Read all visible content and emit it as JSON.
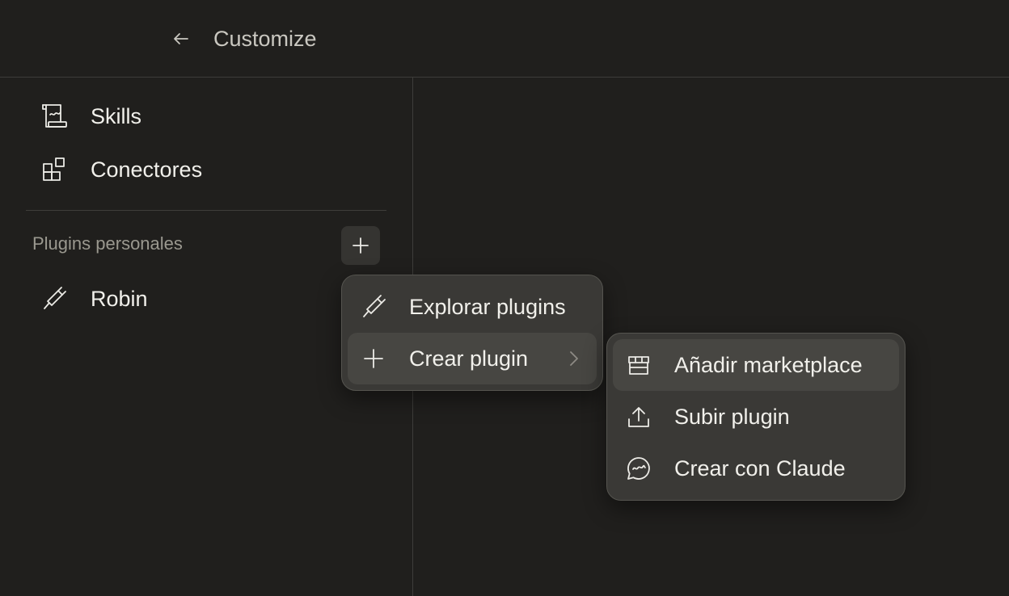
{
  "header": {
    "title": "Customize",
    "back_icon": "arrow-left-icon"
  },
  "sidebar": {
    "items": [
      {
        "label": "Skills",
        "icon": "scroll-icon"
      },
      {
        "label": "Conectores",
        "icon": "blocks-icon"
      }
    ],
    "section": {
      "label": "Plugins personales",
      "add_icon": "plus-icon",
      "items": [
        {
          "label": "Robin",
          "icon": "plug-icon"
        }
      ]
    }
  },
  "menu": {
    "items": [
      {
        "label": "Explorar plugins",
        "icon": "plug-icon"
      },
      {
        "label": "Crear plugin",
        "icon": "plus-icon",
        "submenu_icon": "chevron-right-icon",
        "active": true
      }
    ]
  },
  "submenu": {
    "items": [
      {
        "label": "Añadir marketplace",
        "icon": "store-icon",
        "active": true
      },
      {
        "label": "Subir plugin",
        "icon": "upload-icon"
      },
      {
        "label": "Crear con Claude",
        "icon": "chat-bubble-icon"
      }
    ]
  },
  "colors": {
    "background": "#201f1d",
    "menu_bg": "#3a3936",
    "menu_hover": "#474642",
    "text": "#ecebe6",
    "muted": "#9a988f"
  }
}
